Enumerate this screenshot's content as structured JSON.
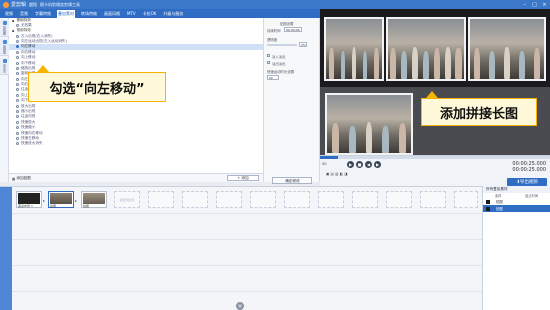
{
  "app": {
    "name": "爱剪辑",
    "menu": [
      "超短",
      "随卡机剪辑卖剪工具"
    ],
    "doc_title": "随卡机剪辑卖剪辑工具"
  },
  "tabs": [
    "视频",
    "音频",
    "字幕特效",
    "叠加素材",
    "转场特效",
    "画面风格",
    "MTV",
    "卡拉OK",
    "升级与服务"
  ],
  "active_tab_index": 3,
  "rail": [
    "加贴图",
    "加相框",
    "去水印"
  ],
  "effects": {
    "groups": [
      {
        "label": "基础特效",
        "items": [
          "无效果"
        ]
      },
      {
        "label": "常用特效",
        "items": [
          "左入出现(右入消失)",
          "向左运动出现(左入运动消失)",
          "向左移动",
          "向右移动",
          "向上移动",
          "向下移动",
          "缩放出现",
          "旋转出现",
          "向左旋转",
          "向右旋转",
          "往返运动",
          "向上升起",
          "向下落下",
          "放大出现",
          "缩小出现",
          "往返闪现",
          "快速放大",
          "快速缩小",
          "快速向右移动",
          "快速左移动",
          "快速放大消失"
        ]
      }
    ],
    "selected": "向左移动"
  },
  "left_footer": {
    "list_label": "添加贴图",
    "add_button": "添加"
  },
  "settings": {
    "header": "贴图设置",
    "duration_label": "持续时间",
    "duration_value": "00:00:06",
    "opacity_label": "透明度",
    "opacity_value": "0%",
    "fadein_label": "淡入淡出",
    "fadeout_label": "淡出淡出",
    "motion_label": "快速运动时长设置",
    "motion_value": "00",
    "apply_button": "确定修改"
  },
  "controls": {
    "current_time": "00:00:25.000",
    "total_time": "00:00:25.000",
    "time_start": "00",
    "progress": 0.08,
    "export_button": "导出视频"
  },
  "timeline": {
    "clips": [
      {
        "label": "美蓝布局 1",
        "color": "#222222"
      },
      {
        "label": "拍图",
        "color": "#8a8070"
      },
      {
        "label": "拍图",
        "color": "#9a8f80"
      }
    ],
    "empty_slot_label": "拖放到此处"
  },
  "right_panel": {
    "header": "所有叠加素材",
    "col_a": "素材",
    "col_b": "起止时间",
    "rows": [
      "拍图",
      "拍图"
    ],
    "selected_index": 1
  },
  "callouts": {
    "left": "勾选“向左移动”",
    "right": "添加拼接长图"
  }
}
